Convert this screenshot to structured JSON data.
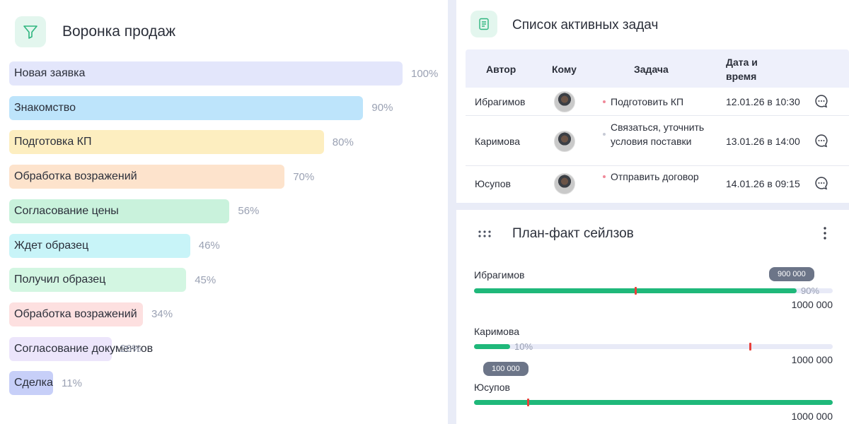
{
  "funnel": {
    "title": "Воронка продаж",
    "icon": "funnel-icon",
    "stages": [
      {
        "label": "Новая заявка",
        "percent": 100,
        "pct_label": "100%",
        "color": "#e3e6fb"
      },
      {
        "label": "Знакомство",
        "percent": 90,
        "pct_label": "90%",
        "color": "#bde4fb"
      },
      {
        "label": "Подготовка КП",
        "percent": 80,
        "pct_label": "80%",
        "color": "#fdeec0"
      },
      {
        "label": "Обработка возражений",
        "percent": 70,
        "pct_label": "70%",
        "color": "#fde3cc"
      },
      {
        "label": "Согласование цены",
        "percent": 56,
        "pct_label": "56%",
        "color": "#c9f2dc"
      },
      {
        "label": "Ждет образец",
        "percent": 46,
        "pct_label": "46%",
        "color": "#c8f4f8"
      },
      {
        "label": "Получил образец",
        "percent": 45,
        "pct_label": "45%",
        "color": "#d3f6e2"
      },
      {
        "label": "Обработка возражений",
        "percent": 34,
        "pct_label": "34%",
        "color": "#fde0e0"
      },
      {
        "label": "Согласование документов",
        "percent": 26,
        "pct_label": "26%",
        "color": "#ece5fb"
      },
      {
        "label": "Сделка",
        "percent": 11,
        "pct_label": "11%",
        "color": "#c7cff8"
      }
    ]
  },
  "tasks": {
    "title": "Список активных задач",
    "icon": "document-list-icon",
    "columns": {
      "author": "Автор",
      "to": "Кому",
      "task": "Задача",
      "date_line1": "Дата и",
      "date_line2": "время"
    },
    "rows": [
      {
        "author": "Ибрагимов",
        "task": "Подготовить КП",
        "date": "12.01.26 в 10:30"
      },
      {
        "author": "Каримова",
        "task": "Связаться, уточнить условия поставки",
        "date": "13.01.26 в 14:00"
      },
      {
        "author": "Юсупов",
        "task": "Отправить договор",
        "date": "14.01.26 в 09:15"
      }
    ]
  },
  "plan_fact": {
    "title": "План-факт сейлзов",
    "icon": "drag-handle-icon",
    "menu_icon": "more-vertical-icon",
    "colors": {
      "fill": "#1fb87a",
      "marker": "#e8403b",
      "track": "#e8eaf7"
    },
    "people": [
      {
        "name": "Ибрагимов",
        "fact": "900 000",
        "fact_fraction": 0.9,
        "pct_label": "90%",
        "plan": "1000 000",
        "marker_fraction": 0.45
      },
      {
        "name": "Каримова",
        "fact": "100 000",
        "fact_fraction": 0.1,
        "pct_label": "10%",
        "plan": "1000 000",
        "marker_fraction": 0.77
      },
      {
        "name": "Юсупов",
        "fact": "",
        "fact_fraction": 1.0,
        "pct_label": "",
        "plan": "1000 000",
        "marker_fraction": 0.15
      }
    ]
  }
}
